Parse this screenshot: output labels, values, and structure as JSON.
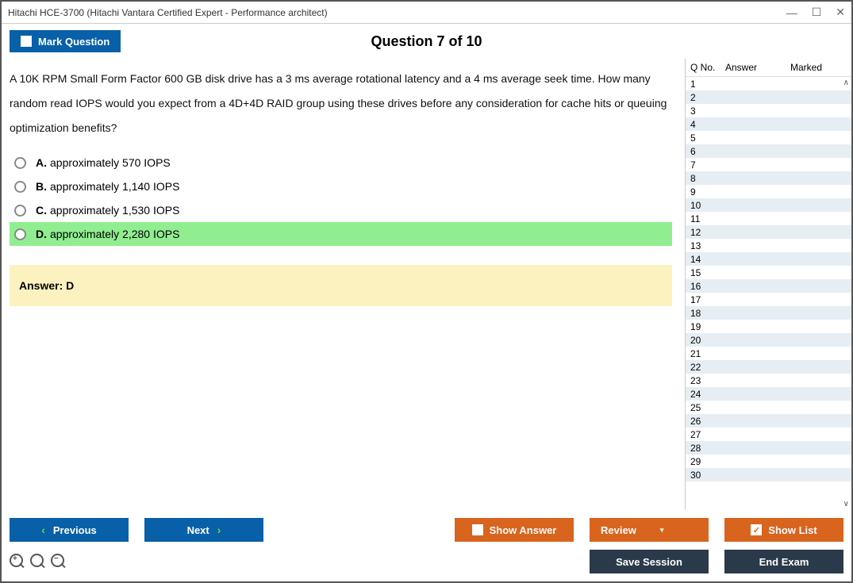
{
  "window": {
    "title": "Hitachi HCE-3700 (Hitachi Vantara Certified Expert - Performance architect)"
  },
  "header": {
    "mark_label": "Mark Question",
    "question_title": "Question 7 of 10"
  },
  "question": {
    "text": "A 10K RPM Small Form Factor 600 GB disk drive has a 3 ms average rotational latency and a 4 ms average seek time. How many random read IOPS would you expect from a 4D+4D RAID group using these drives before any consideration for cache hits or queuing optimization benefits?",
    "options": [
      {
        "letter": "A.",
        "text": "approximately 570 IOPS",
        "highlight": false
      },
      {
        "letter": "B.",
        "text": "approximately 1,140 IOPS",
        "highlight": false
      },
      {
        "letter": "C.",
        "text": "approximately 1,530 IOPS",
        "highlight": false
      },
      {
        "letter": "D.",
        "text": "approximately 2,280 IOPS",
        "highlight": true
      }
    ],
    "answer_label": "Answer: D"
  },
  "side": {
    "headers": {
      "qno": "Q No.",
      "answer": "Answer",
      "marked": "Marked"
    },
    "rows": [
      {
        "n": "1"
      },
      {
        "n": "2"
      },
      {
        "n": "3"
      },
      {
        "n": "4"
      },
      {
        "n": "5"
      },
      {
        "n": "6"
      },
      {
        "n": "7"
      },
      {
        "n": "8"
      },
      {
        "n": "9"
      },
      {
        "n": "10"
      },
      {
        "n": "11"
      },
      {
        "n": "12"
      },
      {
        "n": "13"
      },
      {
        "n": "14"
      },
      {
        "n": "15"
      },
      {
        "n": "16"
      },
      {
        "n": "17"
      },
      {
        "n": "18"
      },
      {
        "n": "19"
      },
      {
        "n": "20"
      },
      {
        "n": "21"
      },
      {
        "n": "22"
      },
      {
        "n": "23"
      },
      {
        "n": "24"
      },
      {
        "n": "25"
      },
      {
        "n": "26"
      },
      {
        "n": "27"
      },
      {
        "n": "28"
      },
      {
        "n": "29"
      },
      {
        "n": "30"
      }
    ]
  },
  "footer": {
    "previous": "Previous",
    "next": "Next",
    "show_answer": "Show Answer",
    "review": "Review",
    "show_list": "Show List",
    "save_session": "Save Session",
    "end_exam": "End Exam"
  }
}
